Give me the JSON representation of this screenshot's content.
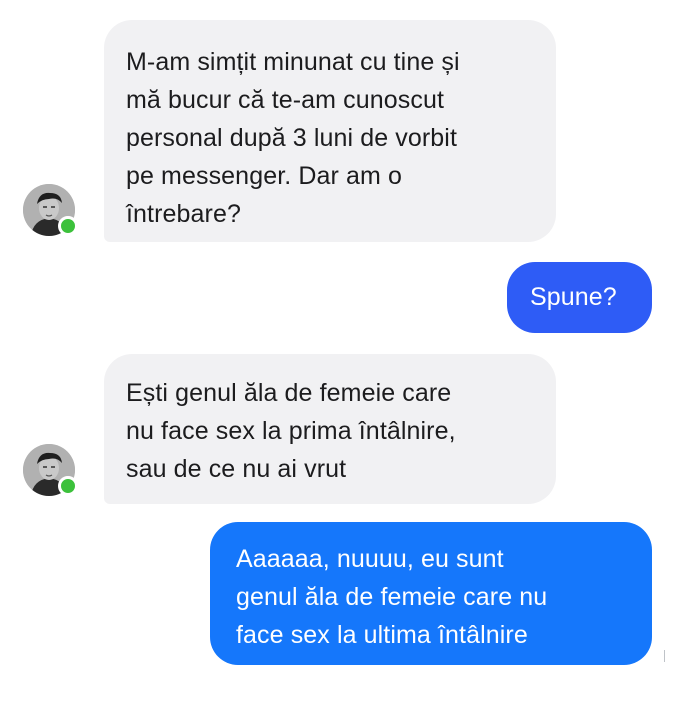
{
  "conversation": {
    "messages": [
      {
        "sender": "contact",
        "text": "M-am simțit minunat cu tine și\nmă bucur că te-am cunoscut\npersonal după 3 luni de vorbit\npe messenger. Dar am o\nîntrebare?"
      },
      {
        "sender": "me",
        "text": "Spune?"
      },
      {
        "sender": "contact",
        "text": "Ești genul ăla de femeie care\nnu face sex la prima întâlnire,\nsau de ce nu ai vrut"
      },
      {
        "sender": "me",
        "text": "Aaaaaa, nuuuu, eu sunt\ngenul ăla de femeie care nu\nface sex la ultima întâlnire"
      }
    ]
  },
  "contact": {
    "avatar_icon": "user-photo-avatar",
    "status": "online",
    "status_color": "#3cc13b"
  },
  "colors": {
    "incoming_bubble": "#f1f1f3",
    "outgoing_bubble": "#1877f2",
    "background": "#ffffff"
  }
}
